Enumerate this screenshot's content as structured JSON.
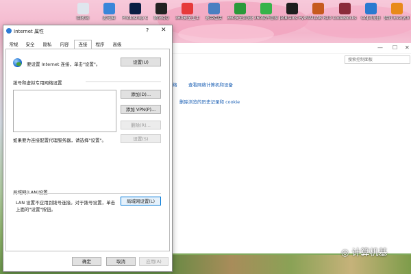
{
  "desktop_icons": [
    {
      "label": "回收站",
      "icon": "recycle-bin-icon",
      "color": "#dfe6ee"
    },
    {
      "label": "此电脑",
      "icon": "computer-icon",
      "color": "#3a86d9"
    },
    {
      "label": "Photoshop CS6绿色版",
      "icon": "photoshop-icon",
      "color": "#0a1f44"
    },
    {
      "label": "腾讯QQ",
      "icon": "qq-icon",
      "color": "#222222"
    },
    {
      "label": "360安全卫士",
      "icon": "360-security-icon",
      "color": "#e63a3a"
    },
    {
      "label": "宽带连接",
      "icon": "broadband-icon",
      "color": "#4a7fc1"
    },
    {
      "label": "360安全浏览器",
      "icon": "360-browser-icon",
      "color": "#2a9a3a"
    },
    {
      "label": "360软件管家",
      "icon": "360-software-icon",
      "color": "#36b34a"
    },
    {
      "label": "JetBrains PyCharm...",
      "icon": "pycharm-icon",
      "color": "#1e1e1e"
    },
    {
      "label": "MATLAB R2016a",
      "icon": "matlab-icon",
      "color": "#c65a1e"
    },
    {
      "label": "CodeBlocks",
      "icon": "codeblocks-icon",
      "color": "#8a2a3a"
    },
    {
      "label": "CAJ浏览器",
      "icon": "caj-icon",
      "color": "#2a7ad0"
    },
    {
      "label": "猎豹 Everything",
      "icon": "everything-icon",
      "color": "#e88a1a"
    }
  ],
  "control_panel": {
    "search_placeholder": "搜索控制面板",
    "link_network": "查看网络计算机和设备",
    "link_network_prefix": "络",
    "link_history": "删除浏览的历史记录和 cookie"
  },
  "dialog": {
    "title": "Internet 属性",
    "help": "?",
    "close": "✕",
    "tabs": [
      "常规",
      "安全",
      "隐私",
      "内容",
      "连接",
      "程序",
      "高级"
    ],
    "active_tab": "连接",
    "setup_text": "要设置 Internet 连接，单击\"设置\"。",
    "setup_button": "设置(U)",
    "vpn_section": "拨号和虚拟专用网络设置",
    "add_button": "添加(D)...",
    "add_vpn_button": "添加 VPN(P)...",
    "delete_button": "删除(R)...",
    "proxy_text": "如果要为连接配置代理服务器，请选择\"设置\"。",
    "settings_button": "设置(S)",
    "lan_section": "局域网(LAN)设置",
    "lan_text_line1": "LAN 设置不应用到拨号连接。对于拨号设置，单击",
    "lan_text_line2": "上面的\"设置\"按钮。",
    "lan_button": "局域网设置(L)",
    "ok_button": "确定",
    "cancel_button": "取消",
    "apply_button": "应用(A)"
  },
  "watermark": "计算机基"
}
